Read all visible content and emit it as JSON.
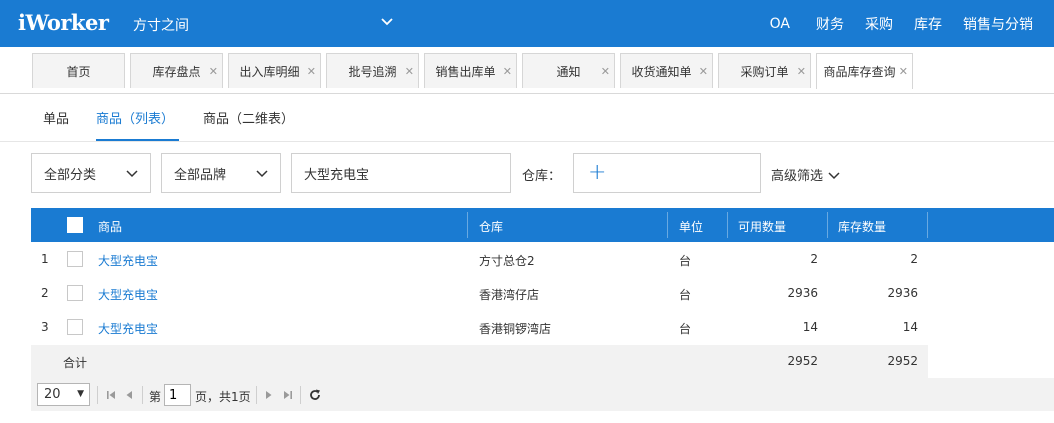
{
  "app": {
    "logo": "iWorker",
    "company": "方寸之间",
    "nav": [
      "OA",
      "财务",
      "采购",
      "库存",
      "销售与分销"
    ]
  },
  "tabs": [
    {
      "label": "首页",
      "closable": false
    },
    {
      "label": "库存盘点",
      "closable": true
    },
    {
      "label": "出入库明细",
      "closable": true
    },
    {
      "label": "批号追溯",
      "closable": true
    },
    {
      "label": "销售出库单",
      "closable": true
    },
    {
      "label": "通知",
      "closable": true
    },
    {
      "label": "收货通知单",
      "closable": true
    },
    {
      "label": "采购订单",
      "closable": true
    },
    {
      "label": "商品库存查询",
      "closable": true,
      "active": true
    }
  ],
  "subtabs": [
    "单品",
    "商品（列表）",
    "商品（二维表）"
  ],
  "active_subtab": "商品（列表）",
  "filters": {
    "category": "全部分类",
    "brand": "全部品牌",
    "search_value": "大型充电宝",
    "warehouse_label": "仓库：",
    "advanced": "高级筛选"
  },
  "table": {
    "columns": [
      "商品",
      "仓库",
      "单位",
      "可用数量",
      "库存数量"
    ],
    "rows": [
      {
        "index": "1",
        "product": "大型充电宝",
        "warehouse": "方寸总仓2",
        "unit": "台",
        "available": "2",
        "stock": "2"
      },
      {
        "index": "2",
        "product": "大型充电宝",
        "warehouse": "香港湾仔店",
        "unit": "台",
        "available": "2936",
        "stock": "2936"
      },
      {
        "index": "3",
        "product": "大型充电宝",
        "warehouse": "香港铜锣湾店",
        "unit": "台",
        "available": "14",
        "stock": "14"
      }
    ],
    "total": {
      "label": "合计",
      "available": "2952",
      "stock": "2952"
    }
  },
  "pager": {
    "page_size": "20",
    "page_prefix": "第",
    "page": "1",
    "page_suffix": "页，共1页"
  },
  "colors": {
    "primary": "#1a7bd2"
  }
}
